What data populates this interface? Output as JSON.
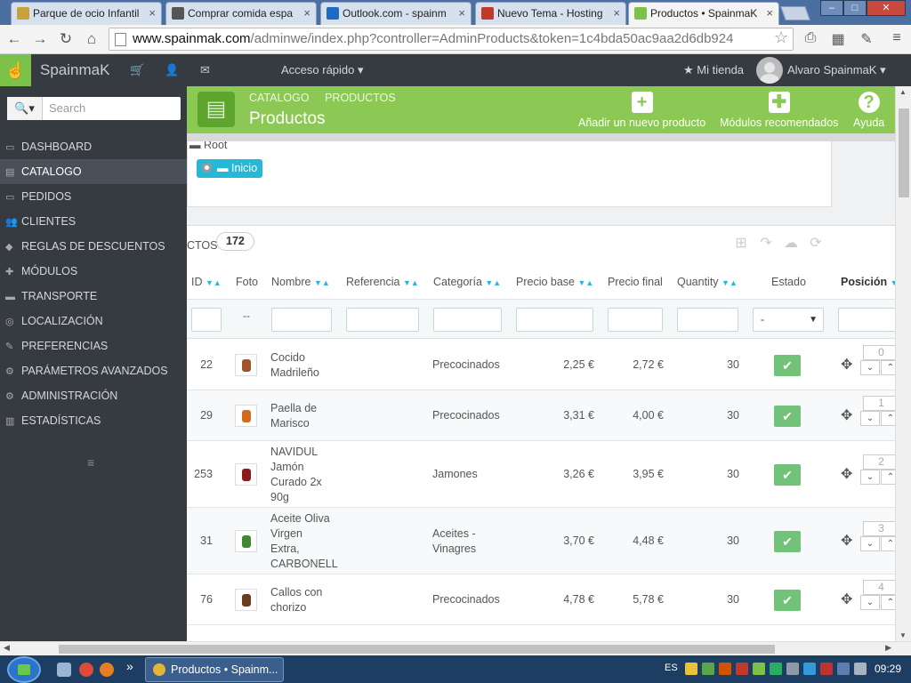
{
  "browser": {
    "tabs": [
      {
        "title": "Parque de ocio Infantil",
        "favicon": "#c8a23a"
      },
      {
        "title": "Comprar comida espa",
        "favicon": "#555555"
      },
      {
        "title": "Outlook.com - spainm",
        "favicon": "#1e6cc1"
      },
      {
        "title": "Nuevo Tema - Hosting",
        "favicon": "#c0392b"
      },
      {
        "title": "Productos • SpainmaK",
        "favicon": "#7cc248"
      }
    ],
    "tab_close": "×",
    "url_domain": "www.spainmak.com",
    "url_path": "/adminwe/index.php?controller=AdminProducts&token=1c4bda50ac9aa2d6db924",
    "window_buttons": {
      "min": "–",
      "max": "□",
      "close": "✕"
    },
    "icons": {
      "back": "←",
      "forward": "→",
      "reload": "↻",
      "home": "⌂",
      "star": "☆",
      "print": "⎙",
      "qr": "▦",
      "pen": "✎",
      "menu": "≡"
    }
  },
  "app": {
    "brand": "SpainmaK",
    "quick_access": "Acceso rápido",
    "my_shop": "Mi tienda",
    "user": "Alvaro SpainmaK",
    "icons": {
      "logo": "☝",
      "cart": "🛒",
      "user": "👤",
      "mail": "✉",
      "star": "★",
      "caret": "▾"
    }
  },
  "sidebar": {
    "search_placeholder": "Search",
    "search_icon": "🔍▾",
    "items": [
      {
        "label": "DASHBOARD",
        "icon": "▭"
      },
      {
        "label": "CATALOGO",
        "icon": "▤"
      },
      {
        "label": "PEDIDOS",
        "icon": "▭"
      },
      {
        "label": "CLIENTES",
        "icon": "👥"
      },
      {
        "label": "REGLAS DE DESCUENTOS",
        "icon": "◆"
      },
      {
        "label": "MÓDULOS",
        "icon": "✚"
      },
      {
        "label": "TRANSPORTE",
        "icon": "▬"
      },
      {
        "label": "LOCALIZACIÓN",
        "icon": "◎"
      },
      {
        "label": "PREFERENCIAS",
        "icon": "✎"
      },
      {
        "label": "PARÁMETROS AVANZADOS",
        "icon": "⚙"
      },
      {
        "label": "ADMINISTRACIÓN",
        "icon": "⚙"
      },
      {
        "label": "ESTADÍSTICAS",
        "icon": "▥"
      }
    ],
    "collapse_icon": "≡"
  },
  "page": {
    "breadcrumb": [
      "CATALOGO",
      "PRODUCTOS"
    ],
    "title": "Productos",
    "book_icon": "▤",
    "actions": [
      {
        "label": "Añadir un nuevo producto",
        "icon": "+"
      },
      {
        "label": "Módulos recomendados",
        "icon": "✚"
      },
      {
        "label": "Ayuda",
        "icon": "?"
      }
    ]
  },
  "tree": {
    "root_label": "Root",
    "selected": "Inicio",
    "folder_icon": "▬"
  },
  "list": {
    "count_label": "CTOS",
    "count": "172",
    "toolbar_icons": [
      "⊞",
      "↷",
      "☁",
      "⟳"
    ],
    "columns": [
      "ID",
      "Foto",
      "Nombre",
      "Referencia",
      "Categoría",
      "Precio base",
      "Precio final",
      "Quantity",
      "Estado",
      "Posición"
    ],
    "sort_arrows": "▼▲",
    "filter_dash": "--",
    "estado_filter": "-",
    "select_caret": "▼",
    "status_icon": "✔",
    "drag_icon": "✥",
    "pos_down": "⌄",
    "pos_up": "⌃",
    "rows": [
      {
        "id": "22",
        "name": "Cocido\nMadrileño",
        "ref": "",
        "cat": "Precocinados",
        "base": "2,25 €",
        "final": "2,72 €",
        "qty": "30",
        "pos": "0",
        "thumb": "#a0522d"
      },
      {
        "id": "29",
        "name": "Paella de\nMarisco",
        "ref": "",
        "cat": "Precocinados",
        "base": "3,31 €",
        "final": "4,00 €",
        "qty": "30",
        "pos": "1",
        "thumb": "#d2691e"
      },
      {
        "id": "253",
        "name": "NAVIDUL\nJamón\nCurado 2x\n90g",
        "ref": "",
        "cat": "Jamones",
        "base": "3,26 €",
        "final": "3,95 €",
        "qty": "30",
        "pos": "2",
        "thumb": "#8b1a1a"
      },
      {
        "id": "31",
        "name": "Aceite Oliva\nVirgen\nExtra,\nCARBONELL",
        "ref": "",
        "cat": "Aceites -\nVinagres",
        "base": "3,70 €",
        "final": "4,48 €",
        "qty": "30",
        "pos": "3",
        "thumb": "#3f8a2e"
      },
      {
        "id": "76",
        "name": "Callos con\nchorizo",
        "ref": "",
        "cat": "Precocinados",
        "base": "4,78 €",
        "final": "5,78 €",
        "qty": "30",
        "pos": "4",
        "thumb": "#6b3a1f"
      }
    ]
  },
  "taskbar": {
    "active_app": "Productos • Spainm...",
    "lang": "ES",
    "clock": "09:29",
    "more": "»"
  }
}
